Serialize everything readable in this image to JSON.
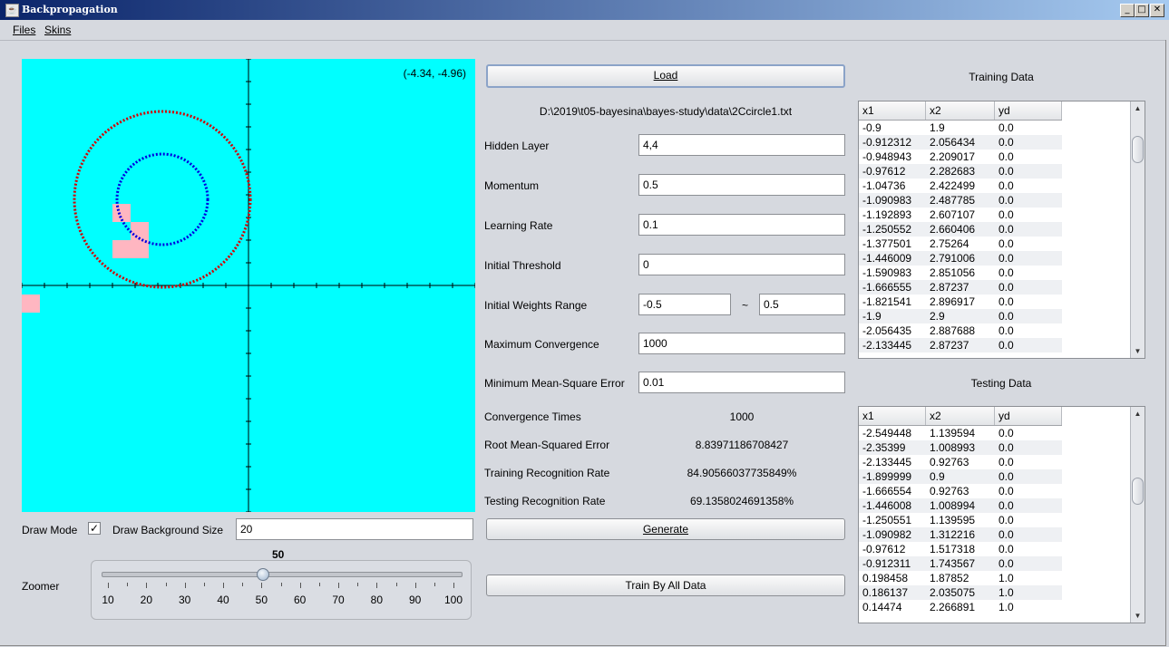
{
  "window": {
    "title": "Backpropagation",
    "minimize": "_",
    "maximize": "□",
    "close": "✕"
  },
  "menu": [
    {
      "label": "Files"
    },
    {
      "label": "Skins"
    }
  ],
  "canvas": {
    "coordinate_readout": "(-4.34, -4.96)"
  },
  "controls": {
    "load_label": "Load",
    "file_path": "D:\\2019\\t05-bayesina\\bayes-study\\data\\2Ccircle1.txt",
    "hidden_layer": {
      "label": "Hidden Layer",
      "value": "4,4"
    },
    "momentum": {
      "label": "Momentum",
      "value": "0.5"
    },
    "learning_rate": {
      "label": "Learning Rate",
      "value": "0.1"
    },
    "initial_threshold": {
      "label": "Initial Threshold",
      "value": "0"
    },
    "initial_weights": {
      "label": "Initial Weights Range",
      "min": "-0.5",
      "sep": "~",
      "max": "0.5"
    },
    "max_convergence": {
      "label": "Maximum Convergence",
      "value": "1000"
    },
    "min_mse": {
      "label": "Minimum Mean-Square Error",
      "value": "0.01"
    },
    "convergence_times": {
      "label": "Convergence Times",
      "value": "1000"
    },
    "rmse": {
      "label": "Root Mean-Squared Error",
      "value": "8.83971186708427"
    },
    "train_rate": {
      "label": "Training Recognition Rate",
      "value": "84.90566037735849%"
    },
    "test_rate": {
      "label": "Testing Recognition Rate",
      "value": "69.1358024691358%"
    },
    "generate_label": "Generate",
    "train_all_label": "Train By All Data"
  },
  "bottom": {
    "draw_mode_label": "Draw Mode",
    "draw_mode_checked": true,
    "bg_size_label": "Draw Background Size",
    "bg_size_value": "20",
    "zoomer_label": "Zoomer",
    "zoom_value": "50",
    "zoom_ticks": [
      "10",
      "20",
      "30",
      "40",
      "50",
      "60",
      "70",
      "80",
      "90",
      "100"
    ]
  },
  "training": {
    "title": "Training Data",
    "columns": [
      "x1",
      "x2",
      "yd"
    ],
    "rows": [
      [
        "-0.9",
        "1.9",
        "0.0"
      ],
      [
        "-0.912312",
        "2.056434",
        "0.0"
      ],
      [
        "-0.948943",
        "2.209017",
        "0.0"
      ],
      [
        "-0.97612",
        "2.282683",
        "0.0"
      ],
      [
        "-1.04736",
        "2.422499",
        "0.0"
      ],
      [
        "-1.090983",
        "2.487785",
        "0.0"
      ],
      [
        "-1.192893",
        "2.607107",
        "0.0"
      ],
      [
        "-1.250552",
        "2.660406",
        "0.0"
      ],
      [
        "-1.377501",
        "2.75264",
        "0.0"
      ],
      [
        "-1.446009",
        "2.791006",
        "0.0"
      ],
      [
        "-1.590983",
        "2.851056",
        "0.0"
      ],
      [
        "-1.666555",
        "2.87237",
        "0.0"
      ],
      [
        "-1.821541",
        "2.896917",
        "0.0"
      ],
      [
        "-1.9",
        "2.9",
        "0.0"
      ],
      [
        "-2.056435",
        "2.887688",
        "0.0"
      ],
      [
        "-2.133445",
        "2.87237",
        "0.0"
      ]
    ]
  },
  "testing": {
    "title": "Testing Data",
    "columns": [
      "x1",
      "x2",
      "yd"
    ],
    "rows": [
      [
        "-2.549448",
        "1.139594",
        "0.0"
      ],
      [
        "-2.35399",
        "1.008993",
        "0.0"
      ],
      [
        "-2.133445",
        "0.92763",
        "0.0"
      ],
      [
        "-1.899999",
        "0.9",
        "0.0"
      ],
      [
        "-1.666554",
        "0.92763",
        "0.0"
      ],
      [
        "-1.446008",
        "1.008994",
        "0.0"
      ],
      [
        "-1.250551",
        "1.139595",
        "0.0"
      ],
      [
        "-1.090982",
        "1.312216",
        "0.0"
      ],
      [
        "-0.97612",
        "1.517318",
        "0.0"
      ],
      [
        "-0.912311",
        "1.743567",
        "0.0"
      ],
      [
        "0.198458",
        "1.87852",
        "1.0"
      ],
      [
        "0.186137",
        "2.035075",
        "1.0"
      ],
      [
        "0.14474",
        "2.266891",
        "1.0"
      ]
    ]
  },
  "colors": {
    "canvas_bg": "#00ffff",
    "outer_circle": "#d40000",
    "inner_circle": "#0000e0",
    "region": "#ffb6c1"
  }
}
